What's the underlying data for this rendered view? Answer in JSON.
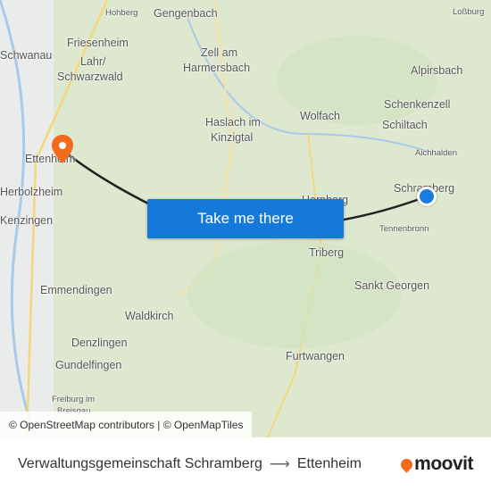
{
  "map": {
    "labels": [
      {
        "t": "Gengenbach"
      },
      {
        "t": "Hohberg",
        "s": 1
      },
      {
        "t": "Loßburg",
        "s": 1
      },
      {
        "t": "Schwanau"
      },
      {
        "t": "Friesenheim"
      },
      {
        "t": "Zell am"
      },
      {
        "t": "Harmersbach"
      },
      {
        "t": "Lahr/"
      },
      {
        "t": "Schwarzwald"
      },
      {
        "t": "Alpirsbach"
      },
      {
        "t": "Schenkenzell"
      },
      {
        "t": "Haslach im"
      },
      {
        "t": "Kinzigtal"
      },
      {
        "t": "Wolfach"
      },
      {
        "t": "Schiltach"
      },
      {
        "t": "Aichhalden",
        "s": 1
      },
      {
        "t": "Ettenheim"
      },
      {
        "t": "Herbolzheim"
      },
      {
        "t": "Schramberg"
      },
      {
        "t": "Hornberg"
      },
      {
        "t": "Kenzingen"
      },
      {
        "t": "Tennenbronn",
        "s": 1
      },
      {
        "t": "Triberg"
      },
      {
        "t": "Sankt Georgen"
      },
      {
        "t": "Emmendingen"
      },
      {
        "t": "Waldkirch"
      },
      {
        "t": "Denzlingen"
      },
      {
        "t": "Gundelfingen"
      },
      {
        "t": "Furtwangen"
      },
      {
        "t": "Freiburg im",
        "s": 1
      },
      {
        "t": "Breisgau",
        "s": 1
      }
    ],
    "colors": {
      "route": "#222222",
      "origin": "#1a7ce0",
      "destination": "#f26a1b"
    }
  },
  "button": {
    "label": "Take me there"
  },
  "attribution": "© OpenStreetMap contributors | © OpenMapTiles",
  "footer": {
    "origin": "Verwaltungsgemeinschaft Schramberg",
    "arrow": "⟶",
    "destination": "Ettenheim",
    "logo": "moovit"
  }
}
